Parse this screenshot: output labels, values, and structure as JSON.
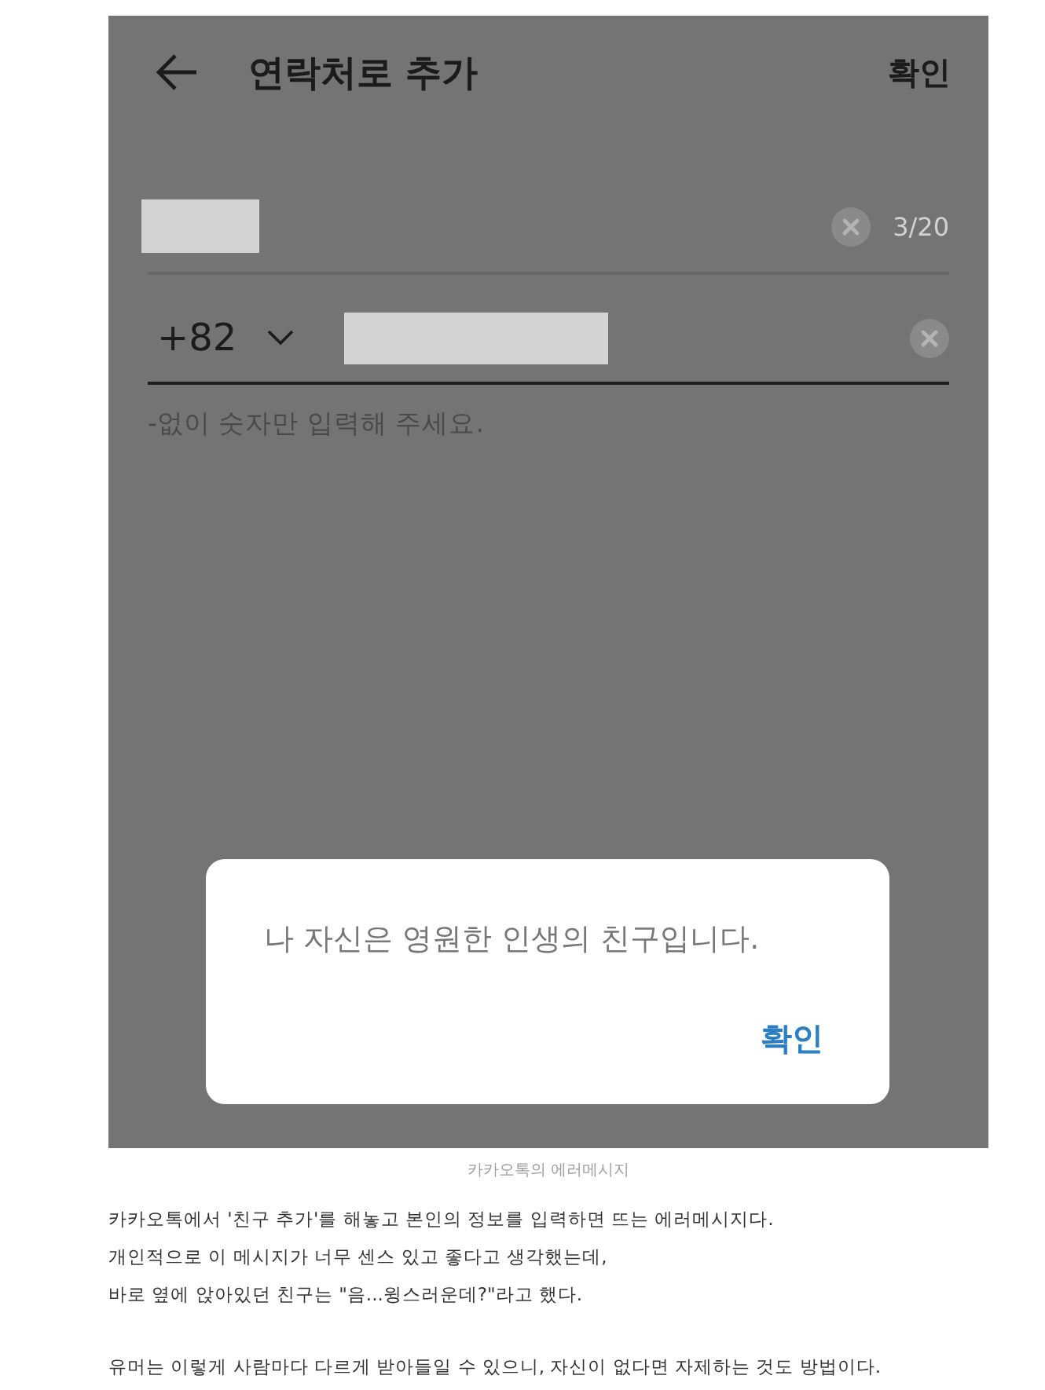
{
  "screenshot": {
    "header": {
      "title": "연락처로 추가",
      "action": "확인"
    },
    "fields": [
      {
        "kind": "name",
        "redacted": true,
        "focused": false,
        "counter": "3/20"
      },
      {
        "kind": "phone",
        "country_code": "+82",
        "redacted": true,
        "focused": true
      }
    ],
    "hint": "-없이 숫자만 입력해 주세요.",
    "dialog": {
      "message": "나 자신은 영원한 인생의 친구입니다.",
      "button": "확인"
    }
  },
  "caption": "카카오톡의 에러메시지",
  "paragraphs": [
    [
      "카카오톡에서 '친구 추가'를 해놓고 본인의 정보를 입력하면 뜨는 에러메시지다.",
      "개인적으로 이 메시지가 너무 센스 있고 좋다고 생각했는데,",
      "바로 옆에 앉아있던 친구는 \"음...윙스러운데?\"라고 했다."
    ],
    [
      "유머는 이렇게 사람마다 다르게 받아들일 수 있으니, 자신이 없다면 자제하는 것도 방법이다."
    ]
  ]
}
